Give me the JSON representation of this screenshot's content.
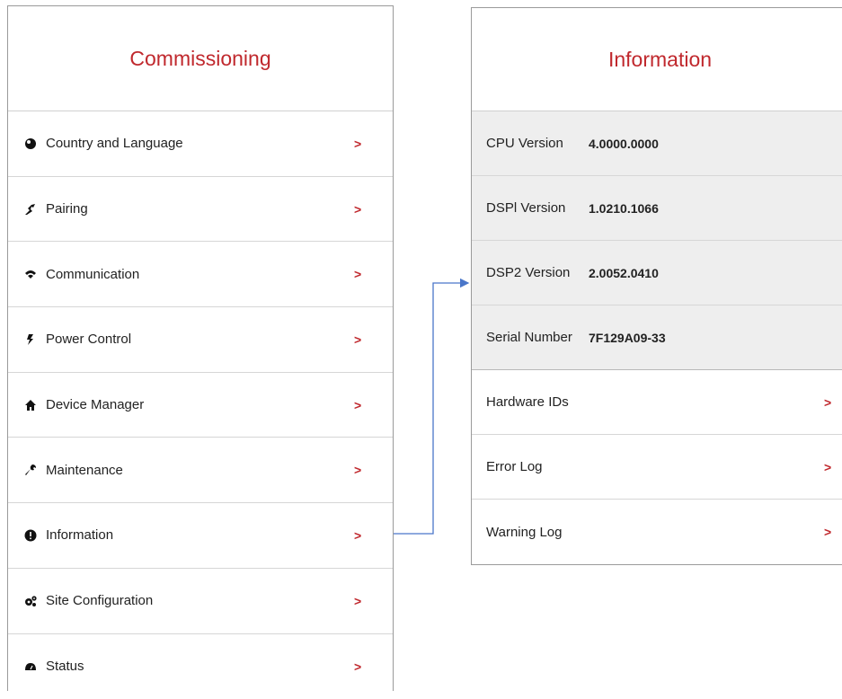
{
  "commissioning": {
    "title": "Commissioning",
    "items": [
      {
        "label": "Country and Language",
        "icon": "globe-icon",
        "arrow": ">"
      },
      {
        "label": "Pairing",
        "icon": "pairing-icon",
        "arrow": ">"
      },
      {
        "label": "Communication",
        "icon": "wifi-icon",
        "arrow": ">"
      },
      {
        "label": "Power Control",
        "icon": "lightning-icon",
        "arrow": ">"
      },
      {
        "label": "Device Manager",
        "icon": "home-icon",
        "arrow": ">"
      },
      {
        "label": "Maintenance",
        "icon": "wrench-icon",
        "arrow": ">"
      },
      {
        "label": "Information",
        "icon": "info-icon",
        "arrow": ">"
      },
      {
        "label": "Site Configuration",
        "icon": "gears-icon",
        "arrow": ">"
      },
      {
        "label": "Status",
        "icon": "gauge-icon",
        "arrow": ">"
      }
    ]
  },
  "information": {
    "title": "Information",
    "rows": [
      {
        "label": "CPU Version",
        "value": "4.0000.0000"
      },
      {
        "label": "DSPl Version",
        "value": "1.0210.1066"
      },
      {
        "label": "DSP2 Version",
        "value": "2.0052.0410"
      },
      {
        "label": "Serial Number",
        "value": "7F129A09-33"
      }
    ],
    "links": [
      {
        "label": "Hardware IDs",
        "arrow": ">"
      },
      {
        "label": "Error Log",
        "arrow": ">"
      },
      {
        "label": "Warning Log",
        "arrow": ">"
      }
    ]
  },
  "colors": {
    "title_red": "#c0282d",
    "connector_blue": "#4a76c9",
    "info_row_bg": "#eeeeee"
  }
}
